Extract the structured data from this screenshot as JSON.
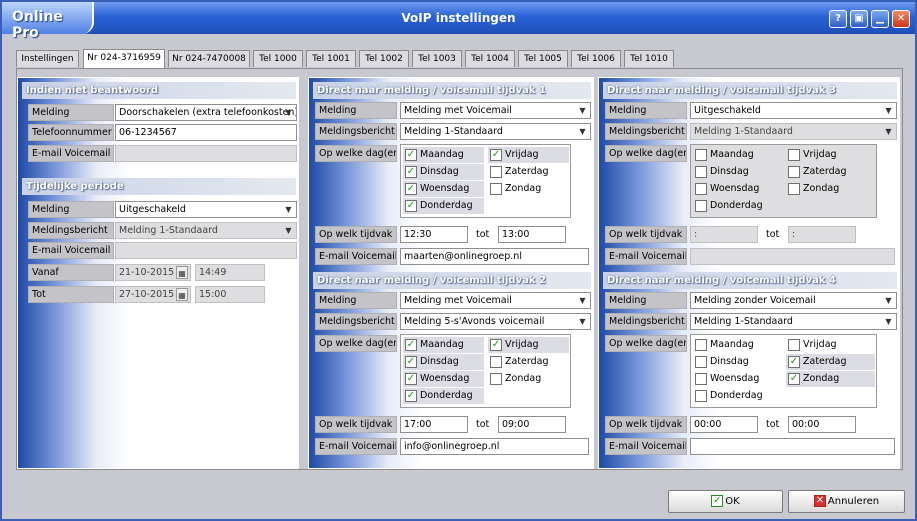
{
  "app": {
    "name": "Online Pro",
    "window_title": "VoIP instellingen"
  },
  "title_buttons": [
    "?",
    "▣",
    "▁",
    "✕"
  ],
  "tabs": [
    "Instellingen",
    "Nr 024-3716959",
    "Nr 024-7470008",
    "Tel 1000",
    "Tel 1001",
    "Tel 1002",
    "Tel 1003",
    "Tel 1004",
    "Tel 1005",
    "Tel 1006",
    "Tel 1010"
  ],
  "left": {
    "header1": "Indien niet beantwoord",
    "melding_label": "Melding",
    "melding_value": "Doorschakelen (extra telefoonkosten)",
    "telefoon_label": "Telefoonnummer",
    "telefoon_value": "06-1234567",
    "email_label": "E-mail Voicemail",
    "email_value": "",
    "header2": "Tijdelijke periode",
    "t_melding_label": "Melding",
    "t_melding_value": "Uitgeschakeld",
    "t_bericht_label": "Meldingsbericht",
    "t_bericht_value": "Melding 1-Standaard",
    "t_email_label": "E-mail Voicemail",
    "t_email_value": "",
    "vanaf_label": "Vanaf",
    "vanaf_date": "21-10-2015",
    "vanaf_time": "14:49",
    "tot_label": "Tot",
    "tot_date": "27-10-2015",
    "tot_time": "15:00"
  },
  "labels": {
    "melding": "Melding",
    "bericht": "Meldingsbericht",
    "dagen": "Op welke dag(en)",
    "tijdvak": "Op welk tijdvak",
    "tot": "tot",
    "email": "E-mail Voicemail"
  },
  "days": [
    "Maandag",
    "Dinsdag",
    "Woensdag",
    "Donderdag",
    "Vrijdag",
    "Zaterdag",
    "Zondag"
  ],
  "periods": [
    {
      "title": "Direct naar melding / voicemail tijdvak 1",
      "melding": "Melding met Voicemail",
      "bericht": "Melding 1-Standaard",
      "checked": [
        true,
        true,
        true,
        true,
        true,
        false,
        false
      ],
      "from": "12:30",
      "to": "13:00",
      "email": "maarten@onlinegroep.nl"
    },
    {
      "title": "Direct naar melding / voicemail tijdvak 2",
      "melding": "Melding met Voicemail",
      "bericht": "Melding 5-s'Avonds voicemail",
      "checked": [
        true,
        true,
        true,
        true,
        true,
        false,
        false
      ],
      "from": "17:00",
      "to": "09:00",
      "email": "info@onlinegroep.nl"
    },
    {
      "title": "Direct naar melding / voicemail tijdvak 3",
      "melding": "Uitgeschakeld",
      "bericht": "Melding 1-Standaard",
      "checked": [
        false,
        false,
        false,
        false,
        false,
        false,
        false
      ],
      "from": ":",
      "to": ":",
      "email": ""
    },
    {
      "title": "Direct naar melding / voicemail tijdvak 4",
      "melding": "Melding zonder Voicemail",
      "bericht": "Melding 1-Standaard",
      "checked": [
        false,
        false,
        false,
        false,
        false,
        true,
        true
      ],
      "from": "00:00",
      "to": "00:00",
      "email": ""
    }
  ],
  "buttons": {
    "ok": "OK",
    "cancel": "Annuleren"
  }
}
